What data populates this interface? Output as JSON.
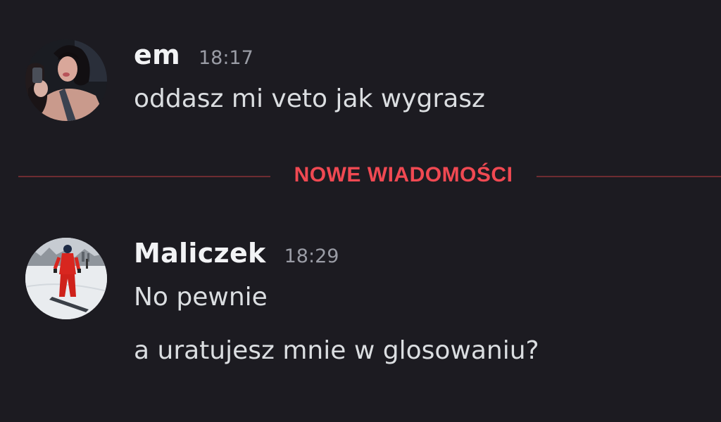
{
  "messages": [
    {
      "username": "em",
      "timestamp": "18:17",
      "lines": [
        "oddasz mi veto jak wygrasz"
      ],
      "avatar_icon": "user-avatar-photo"
    },
    {
      "username": "Maliczek",
      "timestamp": "18:29",
      "lines": [
        "No pewnie",
        "a uratujesz mnie w glosowaniu?"
      ],
      "avatar_icon": "user-avatar-snowboarder-photo"
    }
  ],
  "divider": {
    "label": "NOWE WIADOMOŚCI",
    "color": "#f04952"
  },
  "colors": {
    "background": "#1c1b21",
    "username": "#f2f3f5",
    "timestamp": "#9a9ca5",
    "text": "#dbdee1"
  }
}
